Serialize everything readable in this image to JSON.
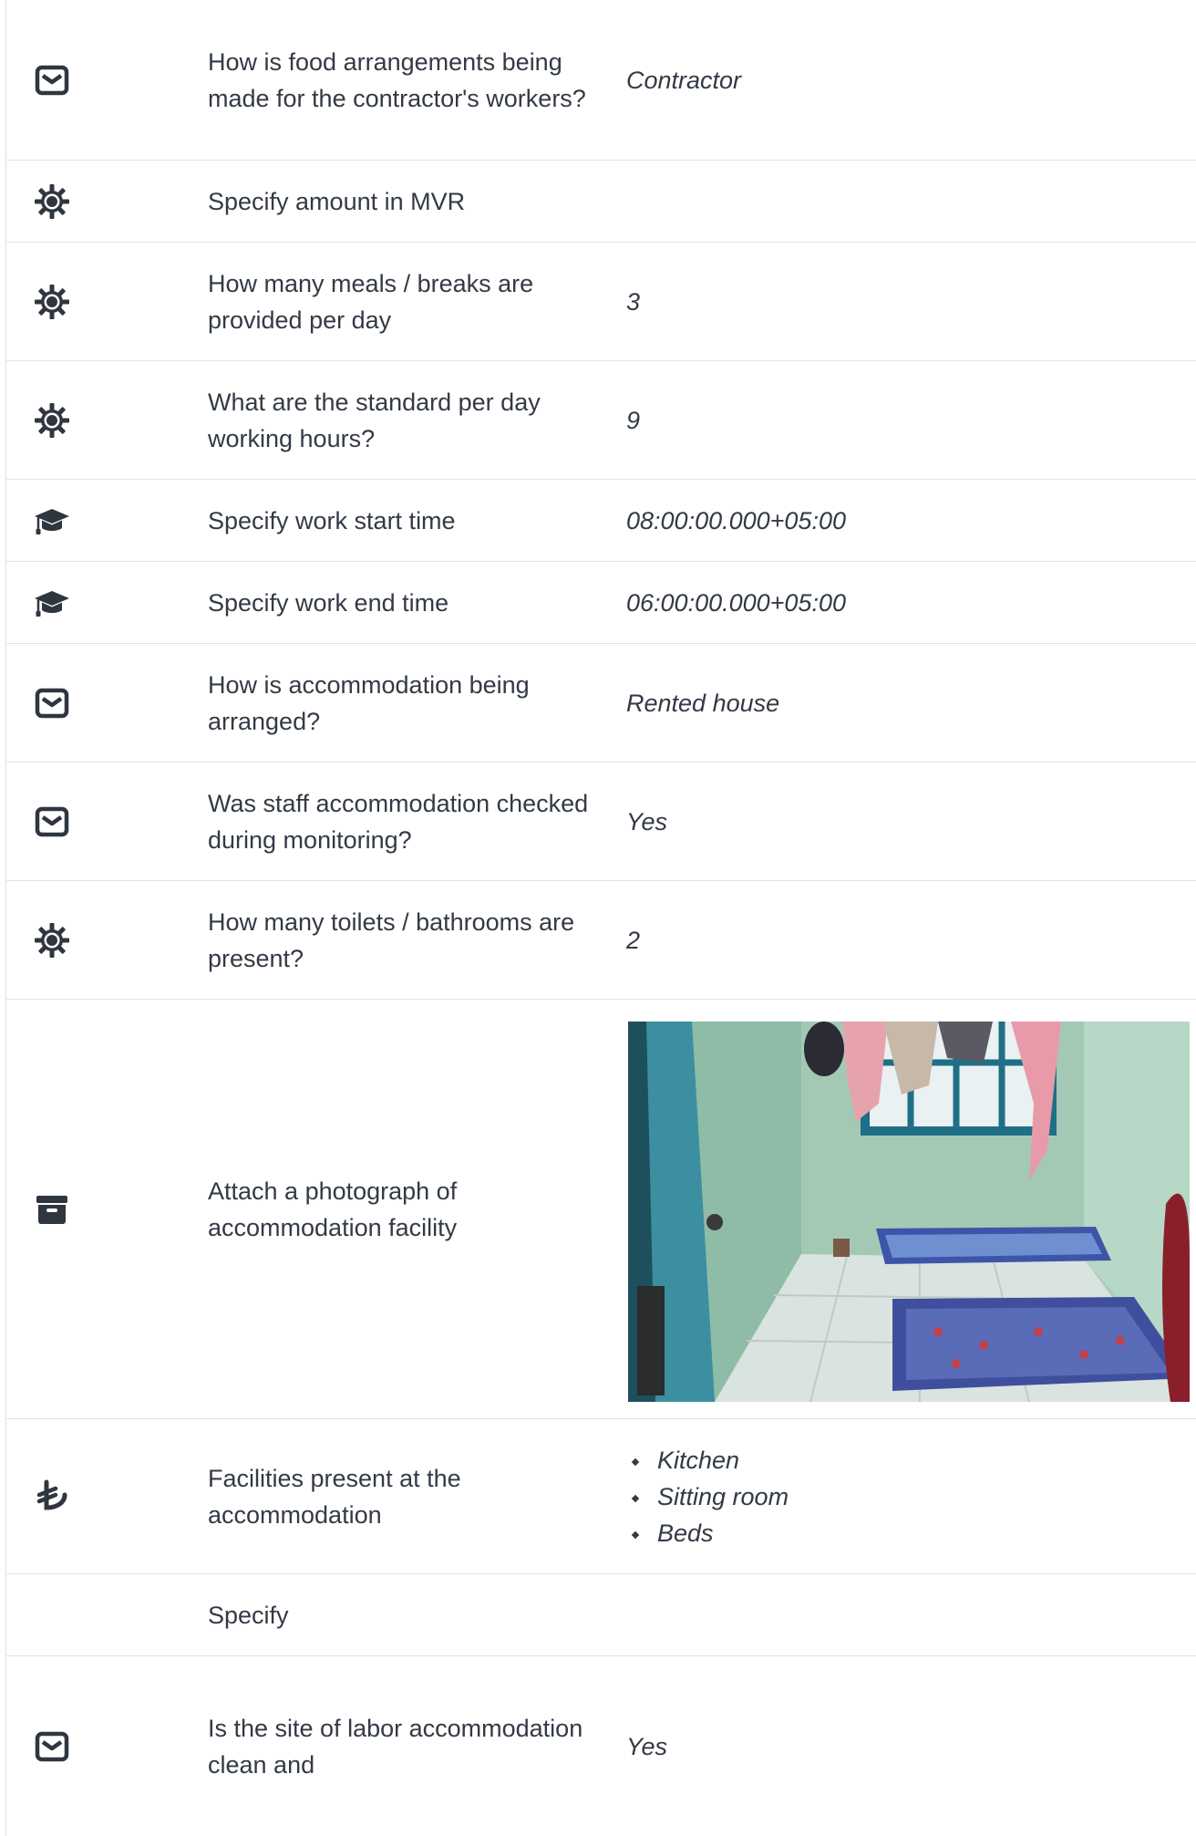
{
  "rows": [
    {
      "icon": "envelope-icon",
      "question": "How is food arrangements being made for the contractor's workers?",
      "answer": "Contractor"
    },
    {
      "icon": "gear-icon",
      "question": "Specify amount in MVR",
      "answer": ""
    },
    {
      "icon": "gear-icon",
      "question": "How many meals / breaks are provided per day",
      "answer": "3"
    },
    {
      "icon": "gear-icon",
      "question": "What are the standard per day working hours?",
      "answer": "9"
    },
    {
      "icon": "graduation-cap-icon",
      "question": "Specify work start time",
      "answer": "08:00:00.000+05:00"
    },
    {
      "icon": "graduation-cap-icon",
      "question": "Specify work end time",
      "answer": "06:00:00.000+05:00"
    },
    {
      "icon": "envelope-icon",
      "question": "How is accommodation being arranged?",
      "answer": "Rented house"
    },
    {
      "icon": "envelope-icon",
      "question": "Was staff accommodation checked during monitoring?",
      "answer": "Yes"
    },
    {
      "icon": "gear-icon",
      "question": "How many toilets / bathrooms are present?",
      "answer": "2"
    },
    {
      "icon": "archive-icon",
      "question": "Attach a photograph of accommodation facility",
      "answer_type": "photo",
      "photo_subject": "Room with two floor mattresses, window with hanging clothes and curtains, open blue door"
    },
    {
      "icon": "lira-icon",
      "question": "Facilities present at the accommodation",
      "answer_list": [
        "Kitchen",
        "Sitting room",
        "Beds"
      ]
    },
    {
      "icon": "",
      "question": "Specify",
      "answer": ""
    },
    {
      "icon": "envelope-icon",
      "question": "Is the site of labor accommodation clean and",
      "answer": "Yes"
    }
  ],
  "colors": {
    "text": "#333a45",
    "border": "#e2e2e2",
    "icon": "#2f3640"
  }
}
